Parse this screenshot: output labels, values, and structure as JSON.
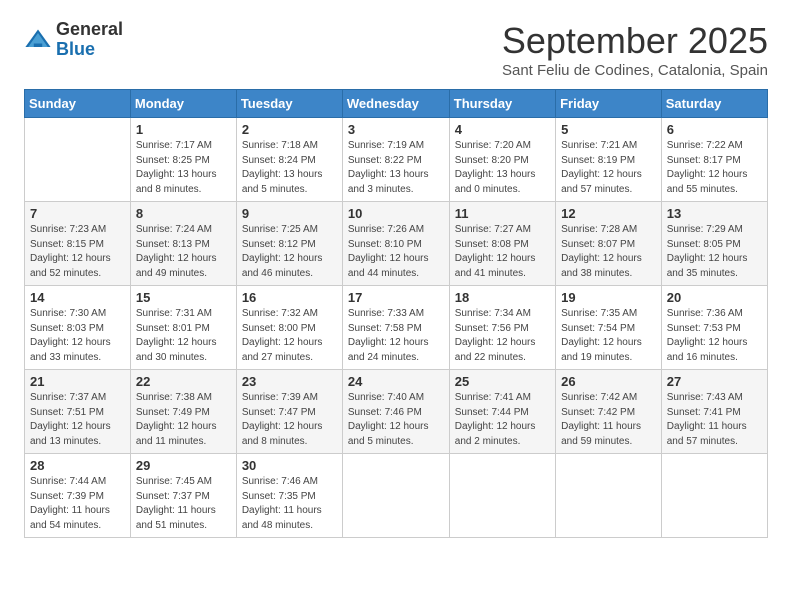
{
  "logo": {
    "general": "General",
    "blue": "Blue"
  },
  "title": "September 2025",
  "location": "Sant Feliu de Codines, Catalonia, Spain",
  "weekdays": [
    "Sunday",
    "Monday",
    "Tuesday",
    "Wednesday",
    "Thursday",
    "Friday",
    "Saturday"
  ],
  "weeks": [
    [
      {
        "day": "",
        "detail": ""
      },
      {
        "day": "1",
        "detail": "Sunrise: 7:17 AM\nSunset: 8:25 PM\nDaylight: 13 hours\nand 8 minutes."
      },
      {
        "day": "2",
        "detail": "Sunrise: 7:18 AM\nSunset: 8:24 PM\nDaylight: 13 hours\nand 5 minutes."
      },
      {
        "day": "3",
        "detail": "Sunrise: 7:19 AM\nSunset: 8:22 PM\nDaylight: 13 hours\nand 3 minutes."
      },
      {
        "day": "4",
        "detail": "Sunrise: 7:20 AM\nSunset: 8:20 PM\nDaylight: 13 hours\nand 0 minutes."
      },
      {
        "day": "5",
        "detail": "Sunrise: 7:21 AM\nSunset: 8:19 PM\nDaylight: 12 hours\nand 57 minutes."
      },
      {
        "day": "6",
        "detail": "Sunrise: 7:22 AM\nSunset: 8:17 PM\nDaylight: 12 hours\nand 55 minutes."
      }
    ],
    [
      {
        "day": "7",
        "detail": "Sunrise: 7:23 AM\nSunset: 8:15 PM\nDaylight: 12 hours\nand 52 minutes."
      },
      {
        "day": "8",
        "detail": "Sunrise: 7:24 AM\nSunset: 8:13 PM\nDaylight: 12 hours\nand 49 minutes."
      },
      {
        "day": "9",
        "detail": "Sunrise: 7:25 AM\nSunset: 8:12 PM\nDaylight: 12 hours\nand 46 minutes."
      },
      {
        "day": "10",
        "detail": "Sunrise: 7:26 AM\nSunset: 8:10 PM\nDaylight: 12 hours\nand 44 minutes."
      },
      {
        "day": "11",
        "detail": "Sunrise: 7:27 AM\nSunset: 8:08 PM\nDaylight: 12 hours\nand 41 minutes."
      },
      {
        "day": "12",
        "detail": "Sunrise: 7:28 AM\nSunset: 8:07 PM\nDaylight: 12 hours\nand 38 minutes."
      },
      {
        "day": "13",
        "detail": "Sunrise: 7:29 AM\nSunset: 8:05 PM\nDaylight: 12 hours\nand 35 minutes."
      }
    ],
    [
      {
        "day": "14",
        "detail": "Sunrise: 7:30 AM\nSunset: 8:03 PM\nDaylight: 12 hours\nand 33 minutes."
      },
      {
        "day": "15",
        "detail": "Sunrise: 7:31 AM\nSunset: 8:01 PM\nDaylight: 12 hours\nand 30 minutes."
      },
      {
        "day": "16",
        "detail": "Sunrise: 7:32 AM\nSunset: 8:00 PM\nDaylight: 12 hours\nand 27 minutes."
      },
      {
        "day": "17",
        "detail": "Sunrise: 7:33 AM\nSunset: 7:58 PM\nDaylight: 12 hours\nand 24 minutes."
      },
      {
        "day": "18",
        "detail": "Sunrise: 7:34 AM\nSunset: 7:56 PM\nDaylight: 12 hours\nand 22 minutes."
      },
      {
        "day": "19",
        "detail": "Sunrise: 7:35 AM\nSunset: 7:54 PM\nDaylight: 12 hours\nand 19 minutes."
      },
      {
        "day": "20",
        "detail": "Sunrise: 7:36 AM\nSunset: 7:53 PM\nDaylight: 12 hours\nand 16 minutes."
      }
    ],
    [
      {
        "day": "21",
        "detail": "Sunrise: 7:37 AM\nSunset: 7:51 PM\nDaylight: 12 hours\nand 13 minutes."
      },
      {
        "day": "22",
        "detail": "Sunrise: 7:38 AM\nSunset: 7:49 PM\nDaylight: 12 hours\nand 11 minutes."
      },
      {
        "day": "23",
        "detail": "Sunrise: 7:39 AM\nSunset: 7:47 PM\nDaylight: 12 hours\nand 8 minutes."
      },
      {
        "day": "24",
        "detail": "Sunrise: 7:40 AM\nSunset: 7:46 PM\nDaylight: 12 hours\nand 5 minutes."
      },
      {
        "day": "25",
        "detail": "Sunrise: 7:41 AM\nSunset: 7:44 PM\nDaylight: 12 hours\nand 2 minutes."
      },
      {
        "day": "26",
        "detail": "Sunrise: 7:42 AM\nSunset: 7:42 PM\nDaylight: 11 hours\nand 59 minutes."
      },
      {
        "day": "27",
        "detail": "Sunrise: 7:43 AM\nSunset: 7:41 PM\nDaylight: 11 hours\nand 57 minutes."
      }
    ],
    [
      {
        "day": "28",
        "detail": "Sunrise: 7:44 AM\nSunset: 7:39 PM\nDaylight: 11 hours\nand 54 minutes."
      },
      {
        "day": "29",
        "detail": "Sunrise: 7:45 AM\nSunset: 7:37 PM\nDaylight: 11 hours\nand 51 minutes."
      },
      {
        "day": "30",
        "detail": "Sunrise: 7:46 AM\nSunset: 7:35 PM\nDaylight: 11 hours\nand 48 minutes."
      },
      {
        "day": "",
        "detail": ""
      },
      {
        "day": "",
        "detail": ""
      },
      {
        "day": "",
        "detail": ""
      },
      {
        "day": "",
        "detail": ""
      }
    ]
  ]
}
